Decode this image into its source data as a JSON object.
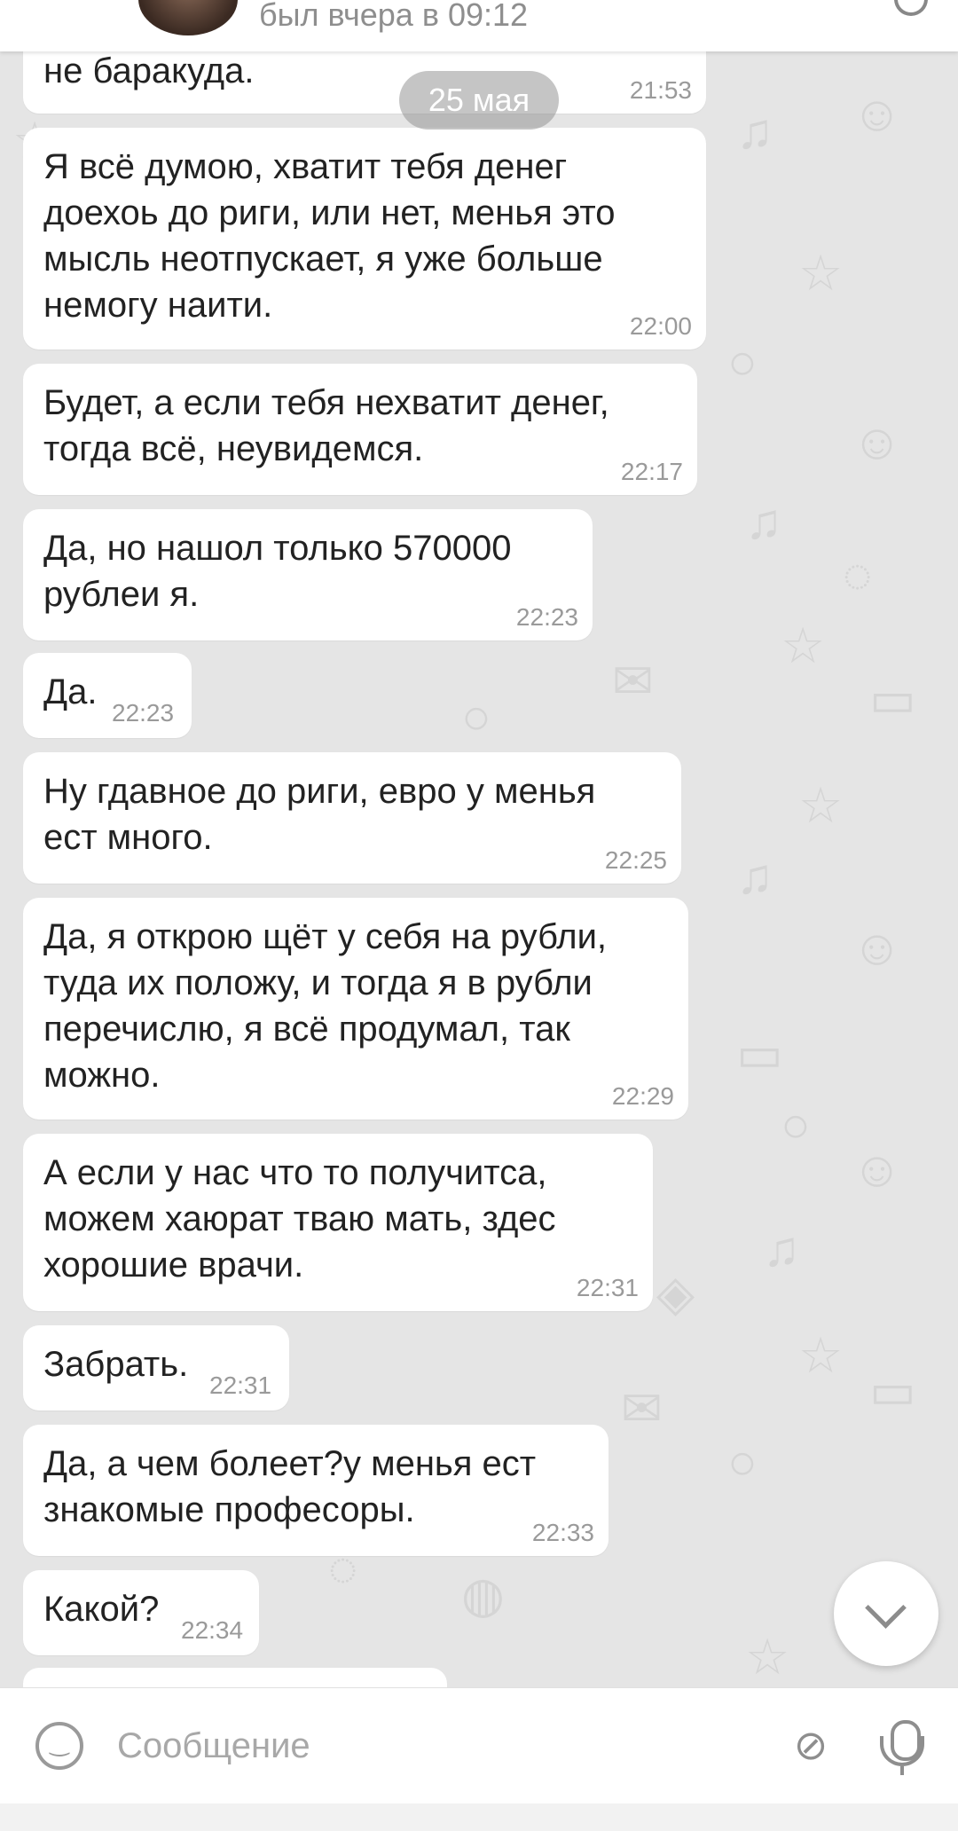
{
  "header": {
    "status": "был вчера в 09:12"
  },
  "date_chip": "25 мая",
  "messages": [
    {
      "text": "не баракуда.",
      "time": "21:53"
    },
    {
      "text": "Я всё думою, хватит тебя денег\nдоехоь до риги, или нет, менья это\nмысль неотпускает, я уже больше\nнемогу наити.",
      "time": "22:00"
    },
    {
      "text": "Будет, а если тебя нехватит денег,\nтогда всё, неувидемся.",
      "time": "22:17"
    },
    {
      "text": "Да, но нашол только 570000\nрублеи я.",
      "time": "22:23"
    },
    {
      "text": "Да.",
      "time": "22:23"
    },
    {
      "text": "Ну гдавное до риги, евро у менья\nест много.",
      "time": "22:25"
    },
    {
      "text": "Да, я открою щёт у себя на рубли,\nтуда их положу, и тогда я в рубли\nперечислю, я всё продумал, так\nможно.",
      "time": "22:29"
    },
    {
      "text": "А если у нас что то получитса,\nможем хаюрат тваю мать, здес\nхорошие врачи.",
      "time": "22:31"
    },
    {
      "text": "Забрать.",
      "time": "22:31"
    },
    {
      "text": "Да, а чем болеет?у менья ест\nзнакомые професоры.",
      "time": "22:33"
    },
    {
      "text": "Какой?",
      "time": "22:34"
    }
  ],
  "composer": {
    "placeholder": "Сообщение"
  },
  "icons": {
    "emoji": "smile-icon",
    "attach": "paperclip-icon",
    "mic": "microphone-icon",
    "scroll_down": "chevron-down-icon"
  }
}
